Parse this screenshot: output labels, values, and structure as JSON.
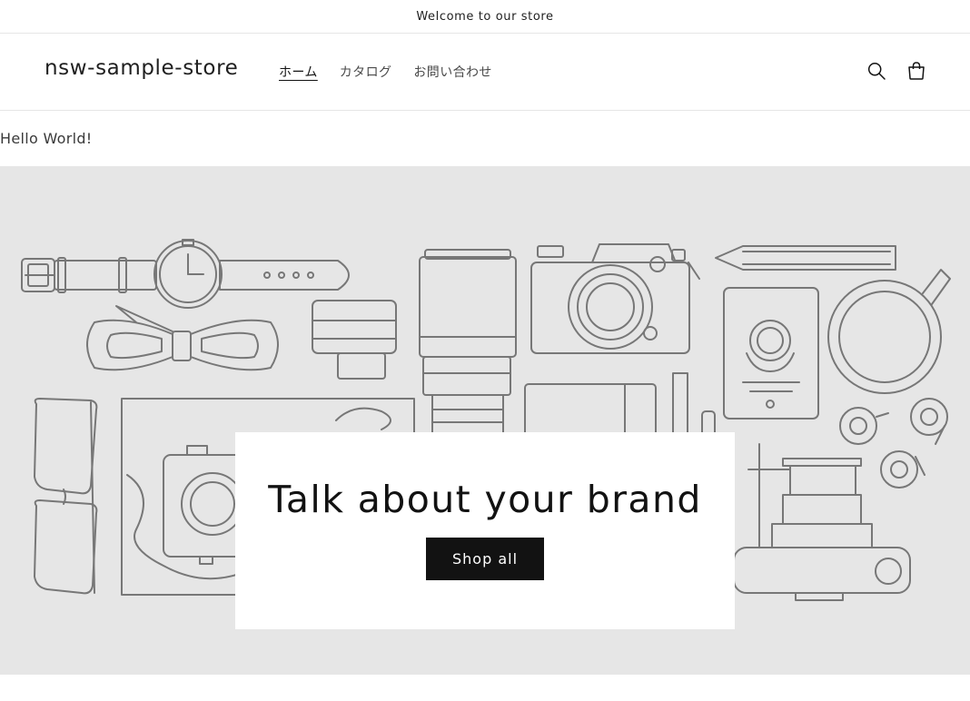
{
  "announcement": {
    "text": "Welcome to our store"
  },
  "header": {
    "logo": "nsw-sample-store",
    "nav": [
      {
        "label": "ホーム",
        "active": true
      },
      {
        "label": "カタログ",
        "active": false
      },
      {
        "label": "お問い合わせ",
        "active": false
      }
    ],
    "icons": {
      "search": "search-icon",
      "cart": "cart-icon"
    }
  },
  "main": {
    "hello": "Hello World!",
    "banner": {
      "heading": "Talk about your brand",
      "button_label": "Shop all",
      "background_color": "#e6e6e6"
    }
  },
  "colors": {
    "primary": "#121212",
    "border": "#e6e6e6",
    "illustration_stroke": "#777777"
  }
}
